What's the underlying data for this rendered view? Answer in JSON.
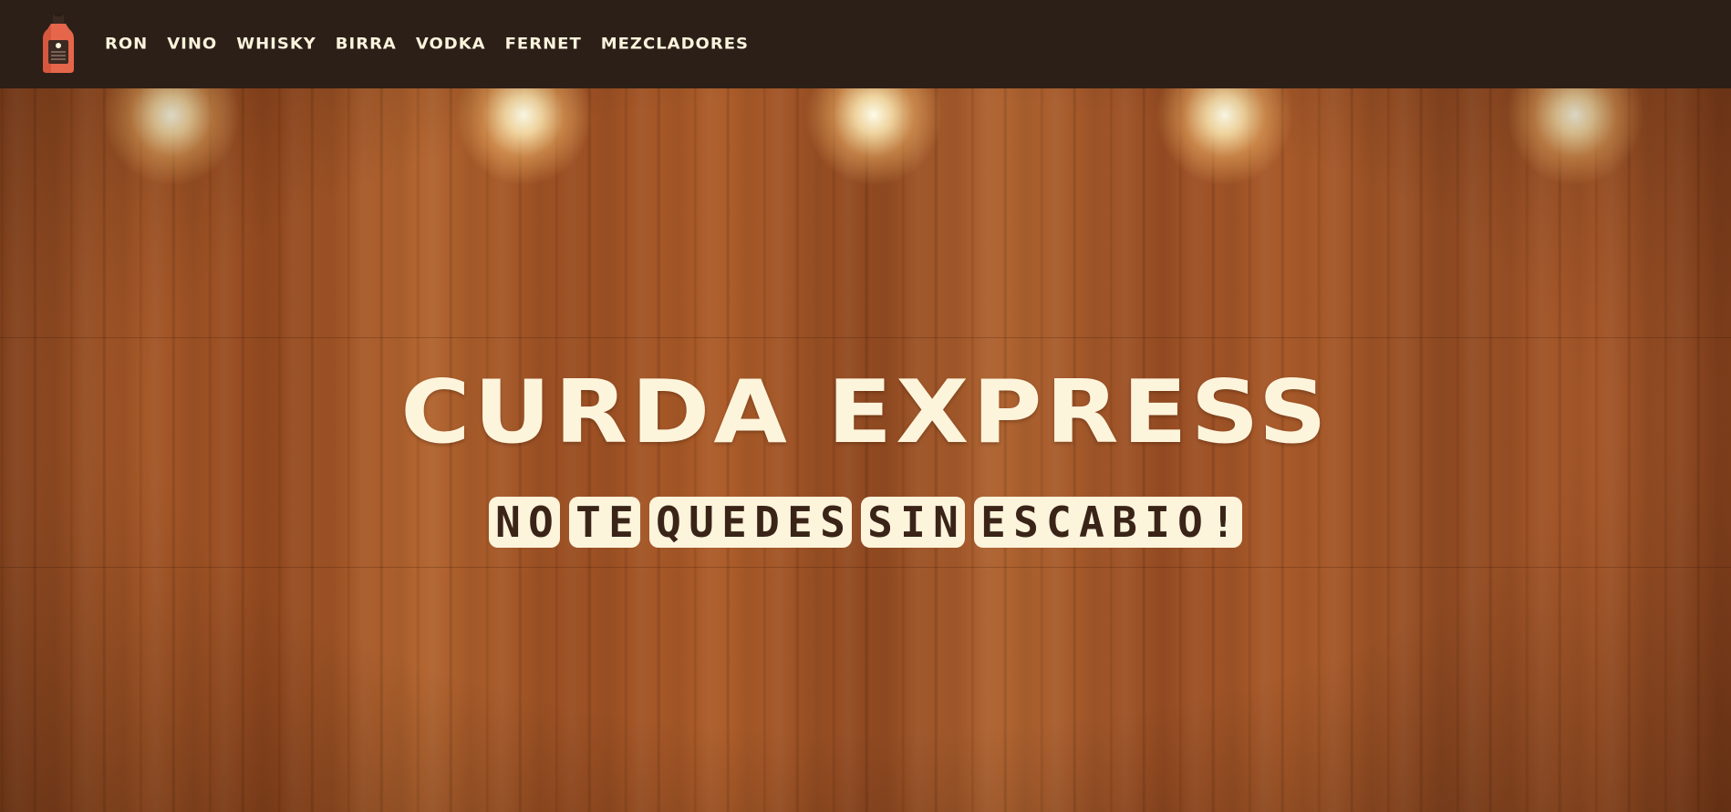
{
  "brand": {
    "logo_icon": "liquor-bottle-icon"
  },
  "nav": {
    "items": [
      {
        "label": "RON"
      },
      {
        "label": "VINO"
      },
      {
        "label": "WHISKY"
      },
      {
        "label": "BIRRA"
      },
      {
        "label": "VODKA"
      },
      {
        "label": "FERNET"
      },
      {
        "label": "MEZCLADORES"
      }
    ]
  },
  "hero": {
    "title": "CURDA EXPRESS",
    "tagline": "NO TE QUEDES SIN ESCABIO!"
  },
  "colors": {
    "navbar_bg": "#2c1f18",
    "text_cream": "#fdf4dc",
    "bottle_orange": "#e5664a",
    "wood": "#a55a2a"
  }
}
